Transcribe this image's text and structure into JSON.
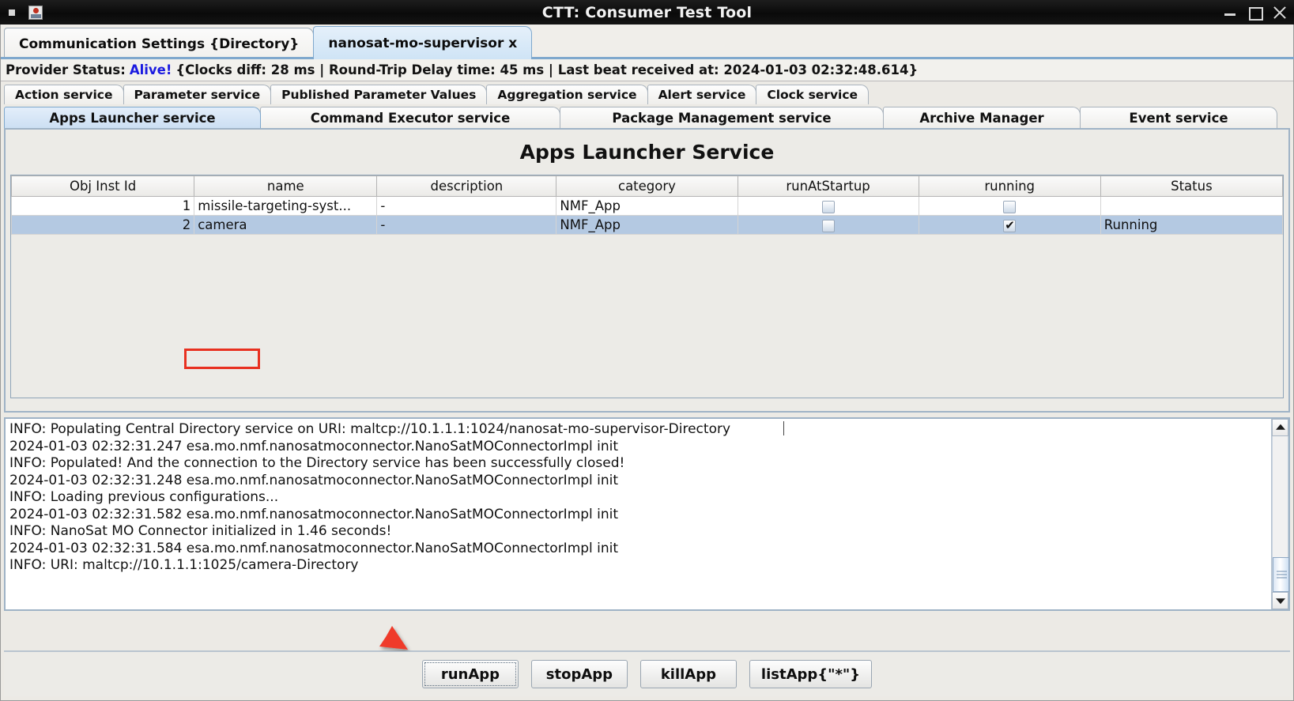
{
  "window": {
    "title": "CTT: Consumer Test Tool",
    "app_icon": "app-icon",
    "controls": {
      "minimize": "minimize-icon",
      "maximize": "maximize-icon",
      "close": "close-icon"
    }
  },
  "top_tabs": [
    {
      "label": "Communication Settings {Directory}",
      "active": false
    },
    {
      "label": "nanosat-mo-supervisor x",
      "active": true
    }
  ],
  "provider_status": {
    "prefix": "Provider Status:",
    "state": "Alive!",
    "details": "{Clocks diff: 28 ms | Round-Trip Delay time: 45 ms | Last beat received at: 2024-01-03 02:32:48.614}"
  },
  "service_tabs_row1": [
    {
      "label": "Action service",
      "active": false
    },
    {
      "label": "Parameter service",
      "active": false
    },
    {
      "label": "Published Parameter Values",
      "active": false
    },
    {
      "label": "Aggregation service",
      "active": false
    },
    {
      "label": "Alert service",
      "active": false
    },
    {
      "label": "Clock service",
      "active": false
    }
  ],
  "service_tabs_row2": [
    {
      "label": "Apps Launcher service",
      "active": true
    },
    {
      "label": "Command Executor service",
      "active": false
    },
    {
      "label": "Package Management service",
      "active": false
    },
    {
      "label": "Archive Manager",
      "active": false
    },
    {
      "label": "Event service",
      "active": false
    }
  ],
  "panel": {
    "title": "Apps Launcher Service",
    "table": {
      "columns": [
        "Obj Inst Id",
        "name",
        "description",
        "category",
        "runAtStartup",
        "running",
        "Status"
      ],
      "rows": [
        {
          "obj_inst_id": "1",
          "name": "missile-targeting-syst...",
          "description": "-",
          "category": "NMF_App",
          "run_at_startup": false,
          "running": false,
          "status": "",
          "selected": false
        },
        {
          "obj_inst_id": "2",
          "name": "camera",
          "description": "-",
          "category": "NMF_App",
          "run_at_startup": false,
          "running": true,
          "status": "Running",
          "selected": true
        }
      ]
    }
  },
  "log": {
    "lines": [
      "INFO: Populating Central Directory service on URI: maltcp://10.1.1.1:1024/nanosat-mo-supervisor-Directory",
      "2024-01-03 02:32:31.247 esa.mo.nmf.nanosatmoconnector.NanoSatMOConnectorImpl init",
      "INFO: Populated! And the connection to the Directory service has been successfully closed!",
      "2024-01-03 02:32:31.248 esa.mo.nmf.nanosatmoconnector.NanoSatMOConnectorImpl init",
      "INFO: Loading previous configurations...",
      "2024-01-03 02:32:31.582 esa.mo.nmf.nanosatmoconnector.NanoSatMOConnectorImpl init",
      "INFO: NanoSat MO Connector initialized in 1.46 seconds!",
      "2024-01-03 02:32:31.584 esa.mo.nmf.nanosatmoconnector.NanoSatMOConnectorImpl init",
      "INFO: URI: maltcp://10.1.1.1:1025/camera-Directory"
    ]
  },
  "buttons": [
    {
      "label": "runApp",
      "focused": true
    },
    {
      "label": "stopApp",
      "focused": false
    },
    {
      "label": "killApp",
      "focused": false
    },
    {
      "label": "listApp{\"*\"}",
      "focused": false
    }
  ],
  "annotations": {
    "highlight_box_target": "camera",
    "arrow_target": "runApp",
    "annotation_color": "#e83020"
  },
  "colors": {
    "accent_blue": "#1a1ae0",
    "selection": "#b4c9e2",
    "tab_active": "#cfe4f6",
    "annotation": "#e83020"
  }
}
